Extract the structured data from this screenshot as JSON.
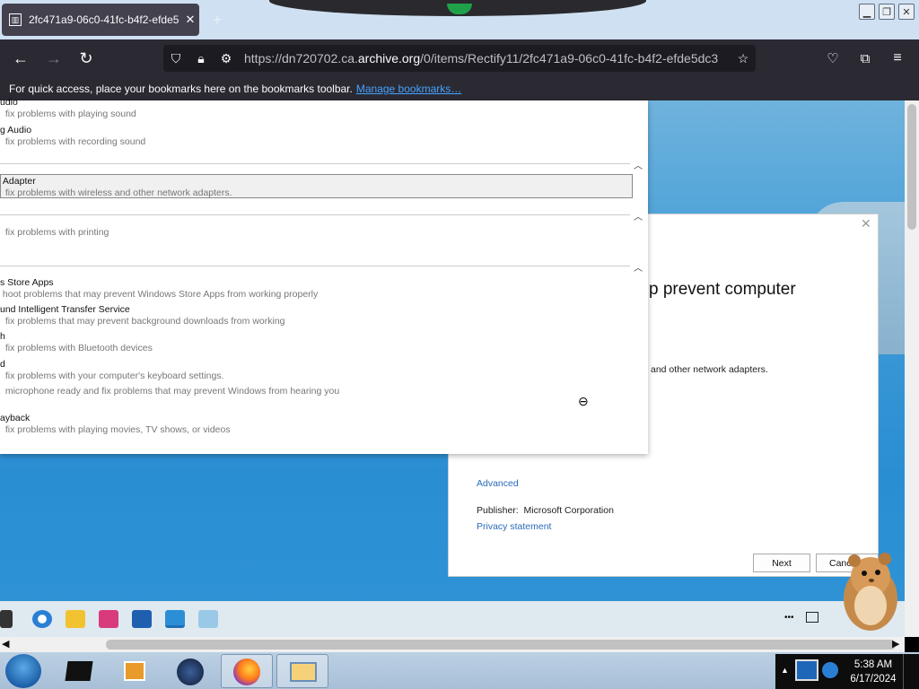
{
  "browser": {
    "tab_title": "2fc471a9-06c0-41fc-b4f2-efde5",
    "tab_close": "✕",
    "new_tab": "+",
    "url_prefix": "https://dn720702.ca.",
    "url_domain": "archive.org",
    "url_suffix": "/0/items/Rectify11/2fc471a9-06c0-41fc-b4f2-efde5dc3",
    "bookmarks_text": "For quick access, place your bookmarks here on the bookmarks toolbar.",
    "bookmarks_link": "Manage bookmarks…"
  },
  "troubleshooter": {
    "items": [
      {
        "title": "udio",
        "desc": "fix problems with playing sound"
      },
      {
        "title": "g Audio",
        "desc": "fix problems with recording sound"
      },
      {
        "title": "Adapter",
        "desc": "fix problems with wireless and other network adapters."
      },
      {
        "title": "",
        "desc": "fix problems with printing"
      },
      {
        "title": "s Store Apps",
        "desc": "hoot problems that may prevent Windows Store Apps from working properly"
      },
      {
        "title": "und Intelligent Transfer Service",
        "desc": "fix problems that may prevent background downloads from working"
      },
      {
        "title": "h",
        "desc": "fix problems with Bluetooth devices"
      },
      {
        "title": "d",
        "desc": "fix problems with your computer's keyboard settings."
      },
      {
        "title": "",
        "desc": "microphone ready and fix problems that may prevent Windows from hearing you"
      },
      {
        "title": "ayback",
        "desc": "fix problems with playing movies, TV shows, or videos"
      }
    ]
  },
  "dialog": {
    "title": "p prevent computer",
    "desc": "and other network adapters.",
    "advanced": "Advanced",
    "publisher_label": "Publisher:",
    "publisher_value": "Microsoft Corporation",
    "privacy": "Privacy statement",
    "next": "Next",
    "cancel": "Canc"
  },
  "taskbar": {
    "time": "5:38 AM",
    "date": "6/17/2024",
    "overflow": "•••"
  }
}
